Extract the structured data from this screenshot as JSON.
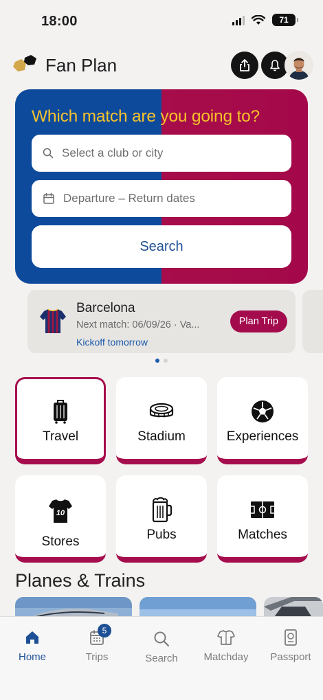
{
  "status_bar": {
    "time": "18:00",
    "battery": "71"
  },
  "header": {
    "brand": "Fan Plan"
  },
  "hero": {
    "title": "Which match are you going to?",
    "club_placeholder": "Select a club or city",
    "dates_placeholder": "Departure – Return dates",
    "search_label": "Search",
    "colors": {
      "blue": "#0d4a9c",
      "garnet": "#a70d4a",
      "title": "#f6c22a"
    }
  },
  "club_card": {
    "name": "Barcelona",
    "next_match": "Next match: 06/09/26 · Va...",
    "kickoff": "Kickoff tomorrow",
    "button": "Plan Trip",
    "page_count": 2,
    "active_page": 0
  },
  "categories": [
    {
      "label": "Travel",
      "icon": "luggage-icon",
      "selected": true
    },
    {
      "label": "Stadium",
      "icon": "stadium-icon",
      "selected": false
    },
    {
      "label": "Experiences",
      "icon": "soccer-ball-icon",
      "selected": false
    },
    {
      "label": "Stores",
      "icon": "jersey-icon",
      "selected": false
    },
    {
      "label": "Pubs",
      "icon": "beer-mug-icon",
      "selected": false
    },
    {
      "label": "Matches",
      "icon": "pitch-icon",
      "selected": false
    }
  ],
  "section": {
    "title": "Planes & Trains"
  },
  "tabs": [
    {
      "label": "Home",
      "icon": "home-icon",
      "active": true
    },
    {
      "label": "Trips",
      "icon": "calendar-icon",
      "badge": "5",
      "active": false
    },
    {
      "label": "Search",
      "icon": "search-icon",
      "active": false
    },
    {
      "label": "Matchday",
      "icon": "shirt-icon",
      "active": false
    },
    {
      "label": "Passport",
      "icon": "passport-icon",
      "active": false
    }
  ],
  "accent_color": "#a30b4d",
  "link_color": "#1d5bab"
}
